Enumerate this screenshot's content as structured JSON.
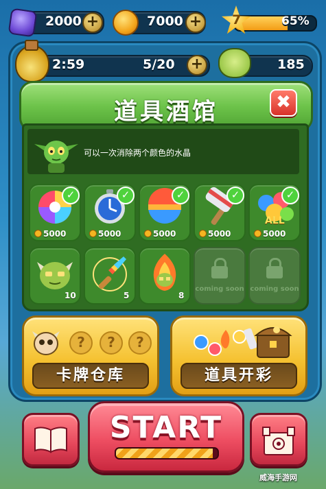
{
  "hud": {
    "gems": "2000",
    "coins": "7000",
    "level": "7",
    "level_progress_percent": "65%",
    "level_progress_fraction": 0.65,
    "timer": "2:59",
    "lives": "5/20",
    "monsters": "185"
  },
  "dialog": {
    "title": "道具酒馆",
    "close_label": "✖",
    "description": "可以一次消除两个颜色的水晶"
  },
  "items_row1": [
    {
      "icon": "rainbow-orb-icon",
      "price": "5000",
      "owned": true
    },
    {
      "icon": "stopwatch-icon",
      "price": "5000",
      "owned": true
    },
    {
      "icon": "color-ball-icon",
      "price": "5000",
      "owned": true
    },
    {
      "icon": "hammer-icon",
      "price": "5000",
      "owned": true
    },
    {
      "icon": "all-balls-icon",
      "price": "5000",
      "owned": true,
      "badge": "ALL"
    }
  ],
  "items_row2": [
    {
      "icon": "horned-monster-icon",
      "count": "10"
    },
    {
      "icon": "magic-brush-icon",
      "count": "5"
    },
    {
      "icon": "fire-monster-icon",
      "count": "8"
    },
    {
      "icon": "lock-icon",
      "locked_text": "coming soon"
    },
    {
      "icon": "lock-icon",
      "locked_text": "coming soon"
    }
  ],
  "cards": {
    "card_storage_label": "卡牌仓库",
    "item_lottery_label": "道具开彩",
    "question_mark": "?"
  },
  "start": {
    "label": "START",
    "progress_fraction": 0.95
  },
  "watermark": "威海手游网",
  "colors": {
    "accent_green": "#6dc34a",
    "accent_red": "#e5465a",
    "accent_gold": "#f5c232",
    "board_blue": "#1d6f9f"
  }
}
